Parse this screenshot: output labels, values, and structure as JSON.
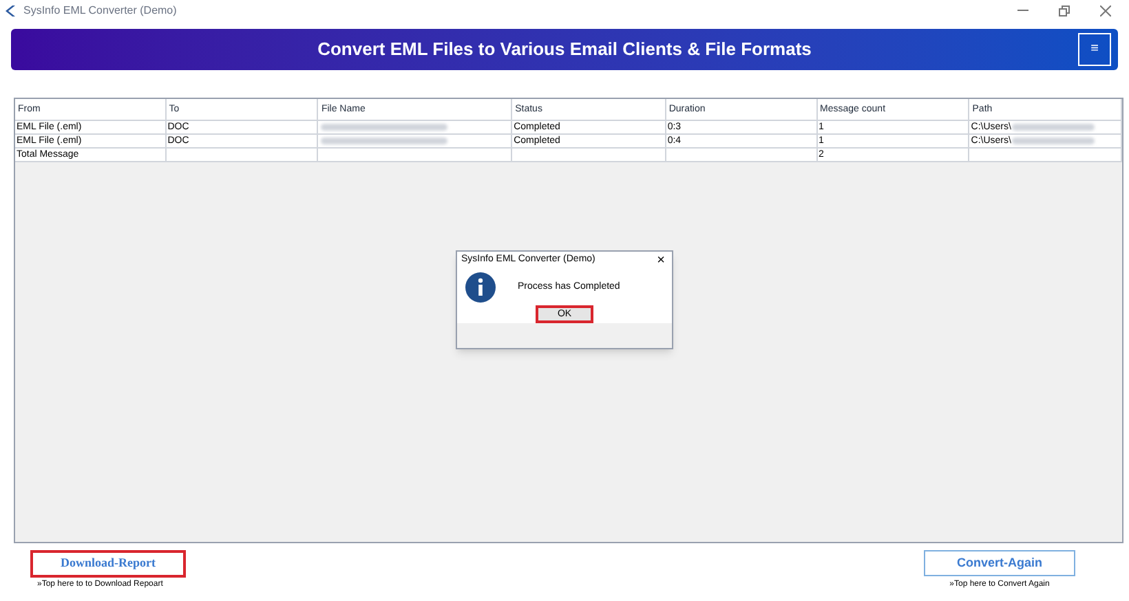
{
  "window": {
    "title": "SysInfo EML Converter (Demo)"
  },
  "banner": {
    "title": "Convert EML Files to Various Email Clients & File Formats",
    "menu": "≡"
  },
  "table": {
    "columns": [
      "From",
      "To",
      "File Name",
      "Status",
      "Duration",
      "Message count",
      "Path"
    ],
    "rows": [
      {
        "cells": [
          "EML File (.eml)",
          "DOC",
          "",
          "Completed",
          "0:3",
          "1",
          "C:\\Users\\"
        ],
        "redacted": [
          false,
          false,
          true,
          false,
          false,
          false,
          true
        ]
      },
      {
        "cells": [
          "EML File (.eml)",
          "DOC",
          "",
          "Completed",
          "0:4",
          "1",
          "C:\\Users\\"
        ],
        "redacted": [
          false,
          false,
          true,
          false,
          false,
          false,
          true
        ]
      },
      {
        "cells": [
          "Total Message",
          "",
          "",
          "",
          "",
          "2",
          ""
        ],
        "redacted": [
          false,
          false,
          false,
          false,
          false,
          false,
          false
        ]
      }
    ]
  },
  "dialog": {
    "title": "SysInfo EML Converter (Demo)",
    "close": "×",
    "message": "Process has Completed",
    "ok": "OK"
  },
  "footer": {
    "download": "Download-Report",
    "download_hint": "»Top here to to Download Repoart",
    "convert": "Convert-Again",
    "convert_hint": "»Top here to Convert Again"
  }
}
